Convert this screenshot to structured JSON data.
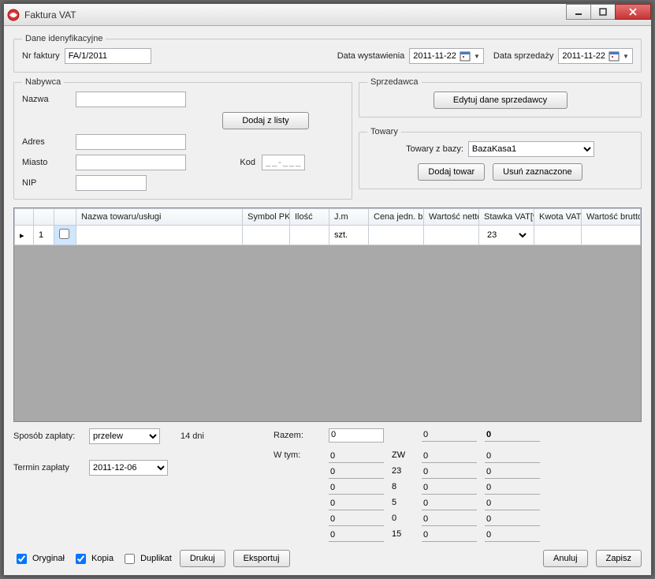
{
  "window": {
    "title": "Faktura VAT"
  },
  "ident": {
    "legend": "Dane idenyfikacyjne",
    "nr_label": "Nr faktury",
    "nr_value": "FA/1/2011",
    "date_issue_label": "Data wystawienia",
    "date_issue_value": "2011-11-22",
    "date_sale_label": "Data sprzedaży",
    "date_sale_value": "2011-11-22"
  },
  "buyer": {
    "legend": "Nabywca",
    "name_label": "Nazwa",
    "name_value": "",
    "addr_label": "Adres",
    "addr_value": "",
    "city_label": "Miasto",
    "city_value": "",
    "kod_label": "Kod",
    "kod_value": "__-___",
    "nip_label": "NIP",
    "nip_value": "",
    "from_list_btn": "Dodaj  z listy"
  },
  "seller": {
    "legend": "Sprzedawca",
    "edit_btn": "Edytuj dane sprzedawcy"
  },
  "goods_panel": {
    "legend": "Towary",
    "from_db_label": "Towary z bazy:",
    "db_value": "BazaKasa1",
    "add_btn": "Dodaj towar",
    "remove_btn": "Usuń zaznaczone"
  },
  "grid": {
    "headers": {
      "name": "Nazwa towaru/usługi",
      "symbol": "Symbol PKWiU",
      "qty": "Ilość",
      "unit": "J.m",
      "unit_gross": "Cena jedn. brutto",
      "net": "Wartość netto",
      "vat_rate": "Stawka VAT[%]",
      "vat_amount": "Kwota VAT",
      "gross": "Wartość brutto"
    },
    "rows": [
      {
        "idx": "1",
        "checked": false,
        "name": "",
        "symbol": "",
        "qty": "",
        "unit": "szt.",
        "unit_gross": "",
        "net": "",
        "vat_rate": "23",
        "vat_amount": "",
        "gross": ""
      }
    ]
  },
  "payment": {
    "method_label": "Sposób zapłaty:",
    "method_value": "przelew",
    "days_text": "14 dni",
    "term_label": "Termin zapłaty",
    "term_value": "2011-12-06"
  },
  "totals": {
    "razem_label": "Razem:",
    "wtym_label": "W tym:",
    "razem": {
      "net": "0",
      "vat": "0",
      "gross": "0"
    },
    "breakdown": [
      {
        "net": "0",
        "rate": "ZW",
        "vat": "0",
        "gross": "0"
      },
      {
        "net": "0",
        "rate": "23",
        "vat": "0",
        "gross": "0"
      },
      {
        "net": "0",
        "rate": "8",
        "vat": "0",
        "gross": "0"
      },
      {
        "net": "0",
        "rate": "5",
        "vat": "0",
        "gross": "0"
      },
      {
        "net": "0",
        "rate": "0",
        "vat": "0",
        "gross": "0"
      },
      {
        "net": "0",
        "rate": "15",
        "vat": "0",
        "gross": "0"
      }
    ]
  },
  "footer": {
    "original": "Oryginał",
    "kopia": "Kopia",
    "duplikat": "Duplikat",
    "print": "Drukuj",
    "export": "Eksportuj",
    "cancel": "Anuluj",
    "save": "Zapisz",
    "checks": {
      "original": true,
      "kopia": true,
      "duplikat": false
    }
  }
}
